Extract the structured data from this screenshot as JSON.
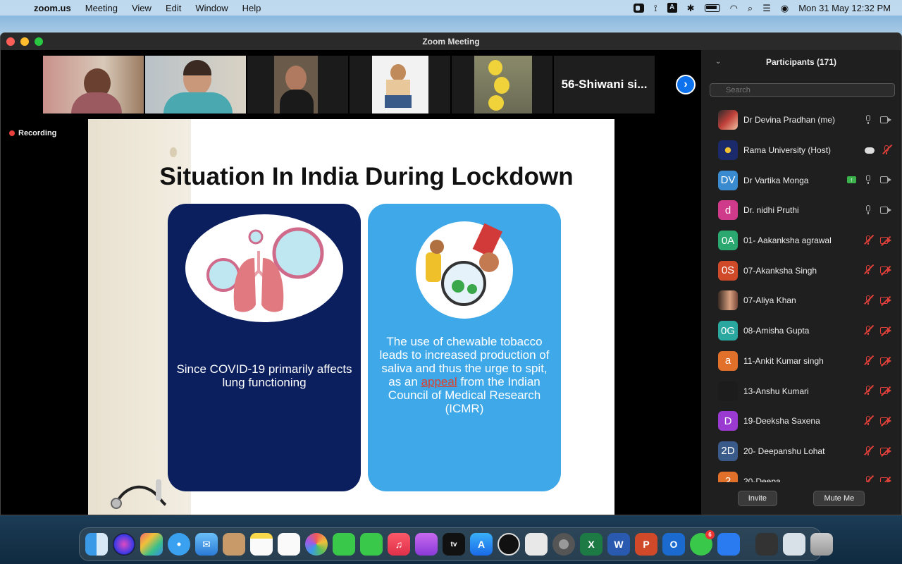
{
  "menubar": {
    "app": "zoom.us",
    "items": [
      "Meeting",
      "View",
      "Edit",
      "Window",
      "Help"
    ],
    "datetime": "Mon 31 May  12:32 PM"
  },
  "window": {
    "title": "Zoom Meeting"
  },
  "thumbnails": {
    "named_tile": "56-Shiwani si..."
  },
  "recording": {
    "label": "Recording"
  },
  "slide": {
    "title": "Situation In India During Lockdown",
    "left_text": "Since COVID-19 primarily affects lung functioning",
    "right_text_before": "The use of chewable tobacco leads to increased production of saliva and thus the urge to spit, as an ",
    "right_text_link": "appeal",
    "right_text_after": " from the Indian Council of Medical Research (ICMR)"
  },
  "participants": {
    "header": "Participants (171)",
    "search_placeholder": "Search",
    "list": [
      {
        "name": "Dr Devina Pradhan (me)",
        "initials": "",
        "color": "#8a4a3a"
      },
      {
        "name": "Rama University (Host)",
        "initials": "",
        "color": "#1a2a6a"
      },
      {
        "name": "Dr Vartika Monga",
        "initials": "DV",
        "color": "#3a8ad0"
      },
      {
        "name": "Dr. nidhi Pruthi",
        "initials": "d",
        "color": "#d03a8a"
      },
      {
        "name": "01- Aakanksha agrawal",
        "initials": "0A",
        "color": "#2aa870"
      },
      {
        "name": "07-Akanksha Singh",
        "initials": "0S",
        "color": "#d04a2a"
      },
      {
        "name": "07-Aliya Khan",
        "initials": "",
        "color": "#7a4a3a"
      },
      {
        "name": "08-Amisha Gupta",
        "initials": "0G",
        "color": "#2aa8a0"
      },
      {
        "name": "11-Ankit Kumar singh",
        "initials": "a",
        "color": "#e0702a"
      },
      {
        "name": "13-Anshu Kumari",
        "initials": "",
        "color": "#1c1c1c"
      },
      {
        "name": "19-Deeksha Saxena",
        "initials": "D",
        "color": "#9a3ad0"
      },
      {
        "name": "20- Deepanshu Lohat",
        "initials": "2D",
        "color": "#3a5a8a"
      },
      {
        "name": "20-Deepa",
        "initials": "2",
        "color": "#e0702a"
      }
    ],
    "invite_label": "Invite",
    "mute_label": "Mute Me"
  },
  "dock": {
    "whatsapp_badge": "6"
  }
}
